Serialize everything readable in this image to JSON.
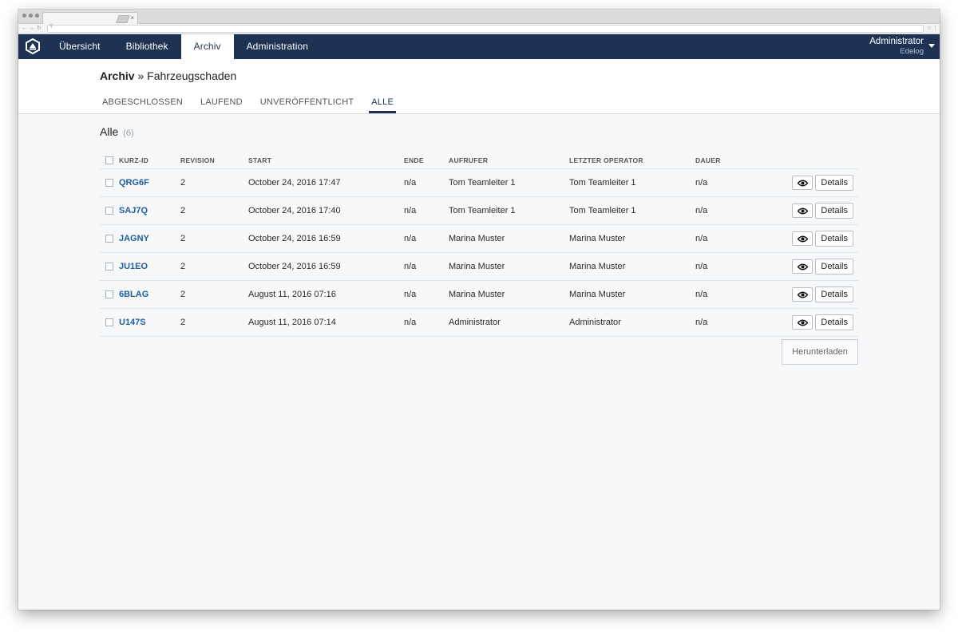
{
  "browser": {
    "tab_close": "×"
  },
  "nav": {
    "items": [
      {
        "label": "Übersicht"
      },
      {
        "label": "Bibliothek"
      },
      {
        "label": "Archiv"
      },
      {
        "label": "Administration"
      }
    ],
    "active_index": 2
  },
  "user": {
    "name": "Administrator",
    "organization": "Edelog"
  },
  "breadcrumb": {
    "section": "Archiv",
    "separator": "»",
    "page": "Fahrzeugschaden"
  },
  "subtabs": {
    "items": [
      {
        "label": "ABGESCHLOSSEN"
      },
      {
        "label": "LAUFEND"
      },
      {
        "label": "UNVERÖFFENTLICHT"
      },
      {
        "label": "ALLE"
      }
    ],
    "active_index": 3
  },
  "list": {
    "title": "Alle",
    "count": "(6)",
    "columns": {
      "kurz_id": "KURZ-ID",
      "revision": "REVISION",
      "start": "START",
      "ende": "ENDE",
      "aufrufer": "AUFRUFER",
      "operator": "LETZTER OPERATOR",
      "dauer": "DAUER"
    },
    "rows": [
      {
        "id": "QRG6F",
        "revision": "2",
        "start": "October 24, 2016 17:47",
        "ende": "n/a",
        "aufrufer": "Tom Teamleiter 1",
        "operator": "Tom Teamleiter 1",
        "dauer": "n/a"
      },
      {
        "id": "SAJ7Q",
        "revision": "2",
        "start": "October 24, 2016 17:40",
        "ende": "n/a",
        "aufrufer": "Tom Teamleiter 1",
        "operator": "Tom Teamleiter 1",
        "dauer": "n/a"
      },
      {
        "id": "JAGNY",
        "revision": "2",
        "start": "October 24, 2016 16:59",
        "ende": "n/a",
        "aufrufer": "Marina Muster",
        "operator": "Marina Muster",
        "dauer": "n/a"
      },
      {
        "id": "JU1EO",
        "revision": "2",
        "start": "October 24, 2016 16:59",
        "ende": "n/a",
        "aufrufer": "Marina Muster",
        "operator": "Marina Muster",
        "dauer": "n/a"
      },
      {
        "id": "6BLAG",
        "revision": "2",
        "start": "August 11, 2016 07:16",
        "ende": "n/a",
        "aufrufer": "Marina Muster",
        "operator": "Marina Muster",
        "dauer": "n/a"
      },
      {
        "id": "U147S",
        "revision": "2",
        "start": "August 11, 2016 07:14",
        "ende": "n/a",
        "aufrufer": "Administrator",
        "operator": "Administrator",
        "dauer": "n/a"
      }
    ],
    "details_label": "Details",
    "view_icon": "eye-icon"
  },
  "download_label": "Herunterladen",
  "colors": {
    "header_bg": "#1e3354",
    "link": "#1f5fa0",
    "page_bg": "#f7f8fa"
  }
}
